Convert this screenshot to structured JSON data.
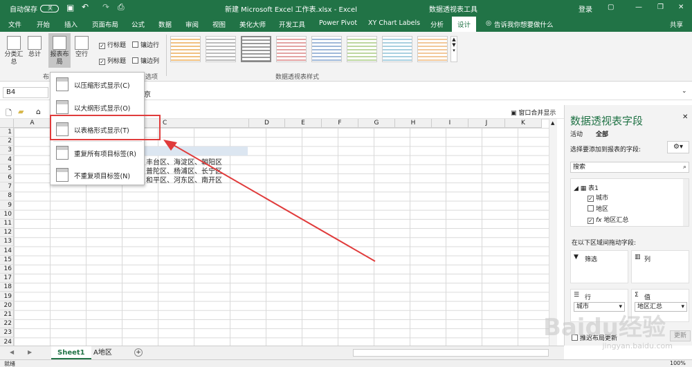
{
  "title": {
    "autosave": "自动保存",
    "autosave_state": "关",
    "doc": "新建 Microsoft Excel 工作表.xlsx  -  Excel",
    "context_tools": "数据透视表工具",
    "login": "登录"
  },
  "tabs": [
    "文件",
    "开始",
    "插入",
    "页面布局",
    "公式",
    "数据",
    "审阅",
    "视图",
    "美化大师",
    "开发工具",
    "Power Pivot",
    "XY Chart Labels",
    "分析",
    "设计"
  ],
  "tell_me": "告诉我你想要做什么",
  "share": "共享",
  "ribbon": {
    "subtotal": "分类汇\n总",
    "total": "总计",
    "report_layout": "报表布\n局",
    "blank_rows": "空行",
    "row_headers": "行标题",
    "banded_rows": "镶边行",
    "col_headers": "列标题",
    "banded_cols": "镶边列",
    "group_layout": "布",
    "group_options": "选项",
    "group_styles": "数据透视表样式"
  },
  "formula_bar": {
    "name_box": "B4",
    "fx": "fx",
    "content": "京"
  },
  "toolstrip": {
    "window_all": "窗口合并显示"
  },
  "columns": [
    "A",
    "B",
    "C",
    "D",
    "E",
    "F",
    "G",
    "H",
    "I",
    "J",
    "K"
  ],
  "rows": [
    "1",
    "2",
    "3",
    "4",
    "5",
    "6",
    "7",
    "8",
    "9",
    "10",
    "11",
    "12",
    "13",
    "14",
    "15",
    "16",
    "17",
    "18",
    "19",
    "20",
    "21",
    "22",
    "23",
    "24"
  ],
  "cells": {
    "r4": "丰台区、海淀区、朝阳区",
    "r5": "普陀区、杨浦区、长宁区",
    "r6": "和平区、河东区、南开区"
  },
  "menu": [
    {
      "label": "以压缩形式显示(C)"
    },
    {
      "label": "以大纲形式显示(O)"
    },
    {
      "label": "以表格形式显示(T)"
    },
    {
      "label": "重复所有项目标签(R)"
    },
    {
      "label": "不重复项目标签(N)"
    }
  ],
  "panel": {
    "title": "数据透视表字段",
    "tab_active": "活动",
    "tab_all": "全部",
    "choose": "选择要添加到报表的字段:",
    "search_placeholder": "搜索",
    "table": "表1",
    "fields": [
      {
        "label": "城市",
        "checked": "✓"
      },
      {
        "label": "地区",
        "checked": ""
      },
      {
        "label": "地区汇总",
        "checked": "✓"
      }
    ],
    "fx": "fx",
    "drag": "在以下区域间拖动字段:",
    "filter": "筛选",
    "columns": "列",
    "rows": "行",
    "values": "值",
    "row_field": "城市",
    "value_field": "地区汇总",
    "defer": "推迟布局更新",
    "update": "更新"
  },
  "sheets": [
    "Sheet1",
    "A地区"
  ],
  "status": {
    "ready": "就绪",
    "zoom": "100%"
  },
  "watermark": "Baidu经验",
  "watermark_url": "jingyan.baidu.com"
}
